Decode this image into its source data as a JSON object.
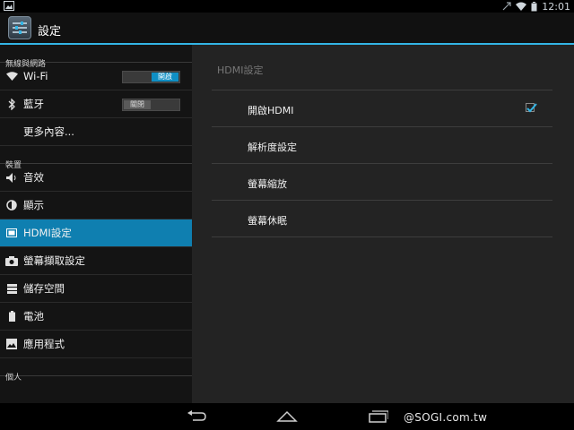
{
  "status_bar": {
    "time": "12:01"
  },
  "action_bar": {
    "title": "設定"
  },
  "sidebar": {
    "sections": [
      {
        "label": "無線與網路"
      },
      {
        "label": "裝置"
      },
      {
        "label": "個人"
      }
    ],
    "items": [
      {
        "label": "Wi-Fi",
        "icon": "wifi-icon",
        "toggle": "開啟",
        "toggle_state": "on"
      },
      {
        "label": "藍牙",
        "icon": "bluetooth-icon",
        "toggle": "關閉",
        "toggle_state": "off"
      },
      {
        "label": "更多內容..."
      },
      {
        "label": "音效",
        "icon": "speaker-icon"
      },
      {
        "label": "顯示",
        "icon": "brightness-icon"
      },
      {
        "label": "HDMI設定",
        "icon": "hdmi-icon",
        "selected": true
      },
      {
        "label": "螢幕擷取設定",
        "icon": "camera-icon"
      },
      {
        "label": "儲存空間",
        "icon": "storage-icon"
      },
      {
        "label": "電池",
        "icon": "battery-icon"
      },
      {
        "label": "應用程式",
        "icon": "apps-icon"
      }
    ]
  },
  "detail": {
    "header": "HDMI設定",
    "rows": [
      {
        "label": "開啟HDMI",
        "checked": true
      },
      {
        "label": "解析度設定"
      },
      {
        "label": "螢幕縮放"
      },
      {
        "label": "螢幕休眠"
      }
    ]
  },
  "watermark": "@SOGI.com.tw",
  "colors": {
    "accent": "#33b5e5",
    "selected": "#0f7fb0"
  }
}
